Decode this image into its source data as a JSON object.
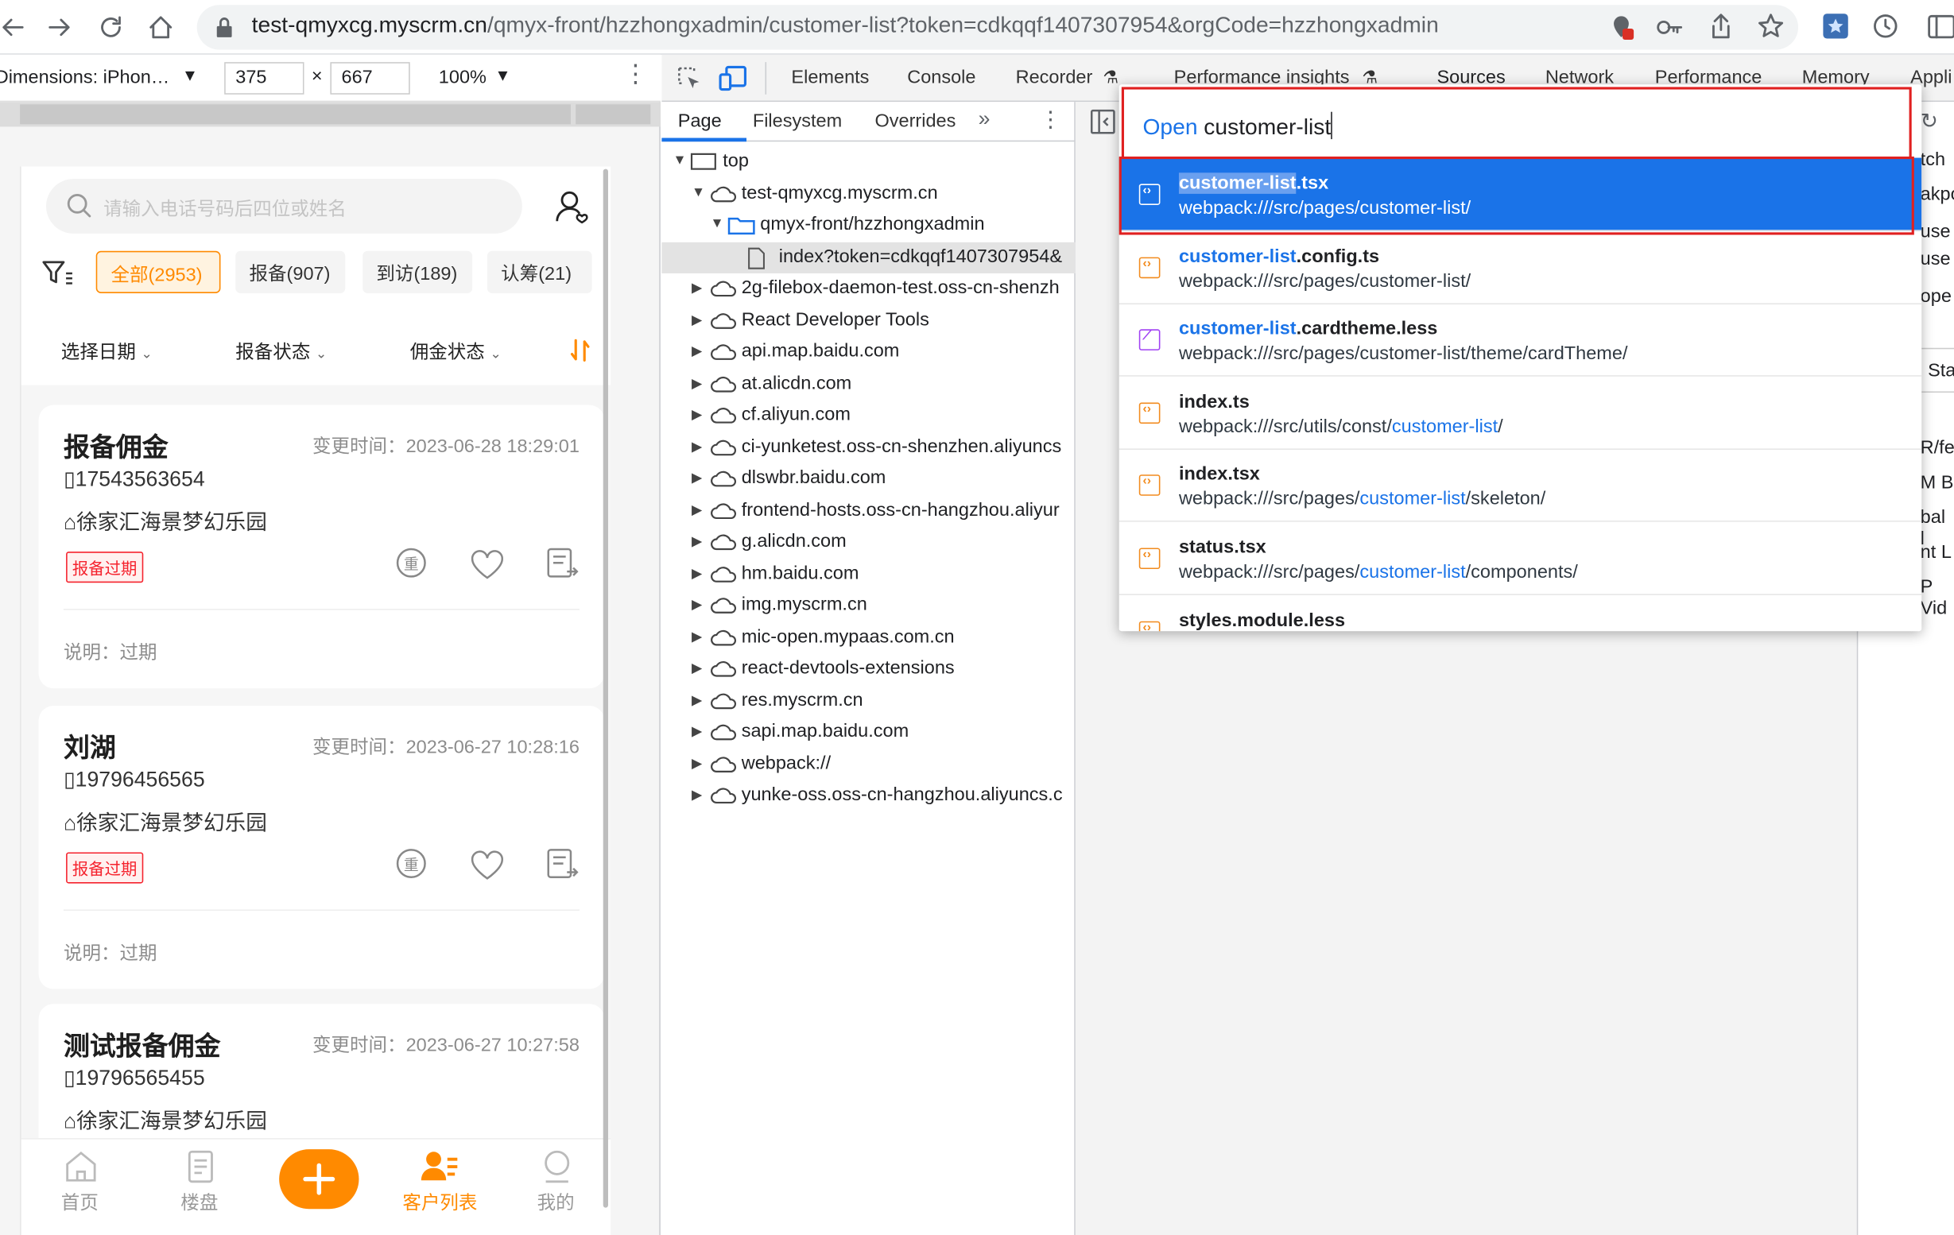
{
  "browser": {
    "url_host": "test-qmyxcg.myscrm.cn",
    "url_rest": "/qmyx-front/hzzhongxadmin/customer-list?token=cdkqqf1407307954&orgCode=hzzhongxadmin"
  },
  "device_toolbar": {
    "dimensions_label": "Dimensions: iPhon…",
    "width": "375",
    "height": "667",
    "zoom": "100%"
  },
  "devtools_tabs": [
    "Elements",
    "Console",
    "Recorder",
    "Performance insights",
    "Sources",
    "Network",
    "Performance",
    "Memory",
    "Appli"
  ],
  "page_panel": {
    "tabs": [
      "Page",
      "Filesystem",
      "Overrides"
    ],
    "tree": [
      {
        "label": "top",
        "kind": "frame",
        "arrow": "▼",
        "indent": 0
      },
      {
        "label": "test-qmyxcg.myscrm.cn",
        "kind": "cloud",
        "arrow": "▼",
        "indent": 1
      },
      {
        "label": "qmyx-front/hzzhongxadmin",
        "kind": "folder",
        "arrow": "▼",
        "indent": 2
      },
      {
        "label": "index?token=cdkqqf1407307954&",
        "kind": "file",
        "arrow": "",
        "indent": 3
      },
      {
        "label": "2g-filebox-daemon-test.oss-cn-shenzh",
        "kind": "cloud",
        "arrow": "▶",
        "indent": 1
      },
      {
        "label": "React Developer Tools",
        "kind": "cloud",
        "arrow": "▶",
        "indent": 1
      },
      {
        "label": "api.map.baidu.com",
        "kind": "cloud",
        "arrow": "▶",
        "indent": 1
      },
      {
        "label": "at.alicdn.com",
        "kind": "cloud",
        "arrow": "▶",
        "indent": 1
      },
      {
        "label": "cf.aliyun.com",
        "kind": "cloud",
        "arrow": "▶",
        "indent": 1
      },
      {
        "label": "ci-yunketest.oss-cn-shenzhen.aliyuncs",
        "kind": "cloud",
        "arrow": "▶",
        "indent": 1
      },
      {
        "label": "dlswbr.baidu.com",
        "kind": "cloud",
        "arrow": "▶",
        "indent": 1
      },
      {
        "label": "frontend-hosts.oss-cn-hangzhou.aliyur",
        "kind": "cloud",
        "arrow": "▶",
        "indent": 1
      },
      {
        "label": "g.alicdn.com",
        "kind": "cloud",
        "arrow": "▶",
        "indent": 1
      },
      {
        "label": "hm.baidu.com",
        "kind": "cloud",
        "arrow": "▶",
        "indent": 1
      },
      {
        "label": "img.myscrm.cn",
        "kind": "cloud",
        "arrow": "▶",
        "indent": 1
      },
      {
        "label": "mic-open.mypaas.com.cn",
        "kind": "cloud",
        "arrow": "▶",
        "indent": 1
      },
      {
        "label": "react-devtools-extensions",
        "kind": "cloud",
        "arrow": "▶",
        "indent": 1
      },
      {
        "label": "res.myscrm.cn",
        "kind": "cloud",
        "arrow": "▶",
        "indent": 1
      },
      {
        "label": "sapi.map.baidu.com",
        "kind": "cloud",
        "arrow": "▶",
        "indent": 1
      },
      {
        "label": "webpack://",
        "kind": "cloud",
        "arrow": "▶",
        "indent": 1
      },
      {
        "label": "yunke-oss.oss-cn-hangzhou.aliyuncs.c",
        "kind": "cloud",
        "arrow": "▶",
        "indent": 1
      }
    ]
  },
  "quick_open": {
    "prefix": "Open",
    "query": "customer-list",
    "results": [
      {
        "pre": "",
        "hl": "customer-list",
        "post": ".tsx",
        "path_pre": "webpack:///src/pages/customer-list/",
        "path_hl": "",
        "path_post": "",
        "icon": "code-file-icon",
        "selected": true
      },
      {
        "pre": "",
        "hl": "customer-list",
        "post": ".config.ts",
        "path_pre": "webpack:///src/pages/customer-list/",
        "path_hl": "",
        "path_post": "",
        "icon": "code-file-icon",
        "selected": false
      },
      {
        "pre": "",
        "hl": "customer-list",
        "post": ".cardtheme.less",
        "path_pre": "webpack:///src/pages/customer-list/theme/cardTheme/",
        "path_hl": "",
        "path_post": "",
        "icon": "style-file-icon",
        "selected": false
      },
      {
        "pre": "index.ts",
        "hl": "",
        "post": "",
        "path_pre": "webpack:///src/utils/const/",
        "path_hl": "customer-list",
        "path_post": "/",
        "icon": "code-file-icon",
        "selected": false
      },
      {
        "pre": "index.tsx",
        "hl": "",
        "post": "",
        "path_pre": "webpack:///src/pages/",
        "path_hl": "customer-list",
        "path_post": "/skeleton/",
        "icon": "code-file-icon",
        "selected": false
      },
      {
        "pre": "status.tsx",
        "hl": "",
        "post": "",
        "path_pre": "webpack:///src/pages/",
        "path_hl": "customer-list",
        "path_post": "/components/",
        "icon": "code-file-icon",
        "selected": false
      },
      {
        "pre": "styles.module.less",
        "hl": "",
        "post": "",
        "path_pre": "",
        "path_hl": "",
        "path_post": "",
        "icon": "code-file-icon",
        "selected": false
      }
    ]
  },
  "right_fragments": [
    "tch",
    "akpo",
    "use",
    "use",
    "ope",
    "Sta",
    "R/fet",
    "M B",
    "bal l",
    "nt L",
    "P Vid"
  ],
  "app": {
    "search_placeholder": "请输入电话号码后四位或姓名",
    "filter_tabs": [
      "全部(2953)",
      "报备(907)",
      "到访(189)",
      "认筹(21)"
    ],
    "dropdowns": [
      "选择日期",
      "报备状态",
      "佣金状态"
    ],
    "cards": [
      {
        "name": "报备佣金",
        "time": "变更时间：2023-06-28 18:29:01",
        "phone": "17543563654",
        "project": "徐家汇海景梦幻乐园",
        "badge": "报备过期",
        "note": "说明：过期"
      },
      {
        "name": "刘湖",
        "time": "变更时间：2023-06-27 10:28:16",
        "phone": "19796456565",
        "project": "徐家汇海景梦幻乐园",
        "badge": "报备过期",
        "note": "说明：过期"
      },
      {
        "name": "测试报备佣金",
        "time": "变更时间：2023-06-27 10:27:58",
        "phone": "19796565455",
        "project": "徐家汇海景梦幻乐园",
        "badge": "",
        "note": ""
      }
    ],
    "nav": [
      "首页",
      "楼盘",
      "",
      "客户列表",
      "我的"
    ],
    "colors": {
      "accent": "#ff8a00",
      "badge": "#f5222d",
      "devtools_blue": "#1a73e8"
    }
  }
}
